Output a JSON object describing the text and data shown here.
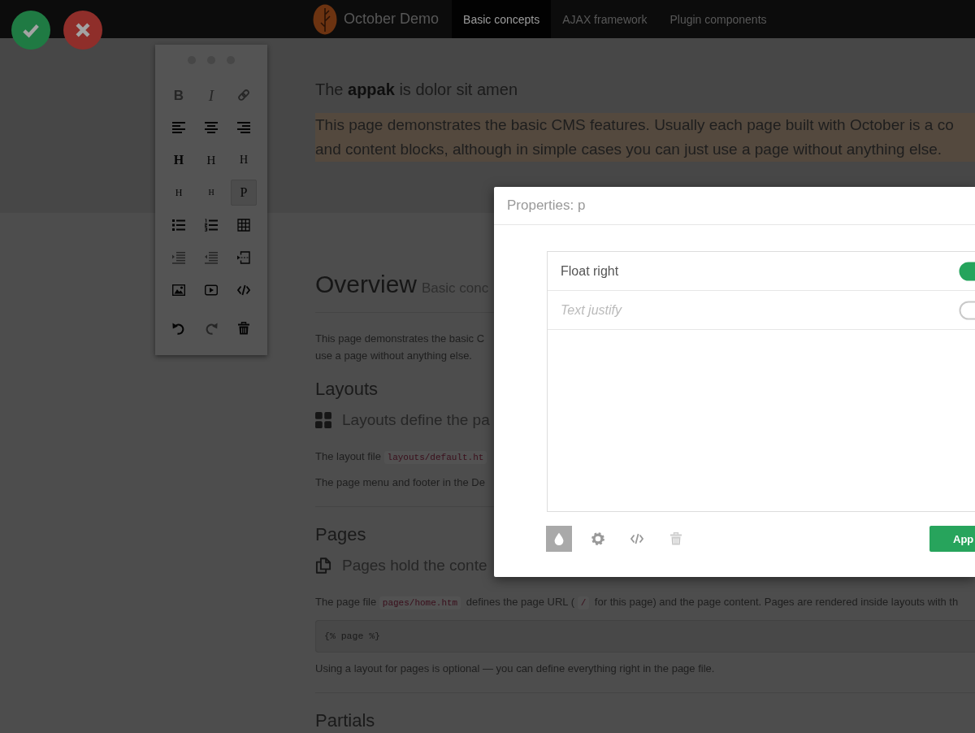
{
  "action_buttons": [
    {
      "kind": "confirm"
    },
    {
      "kind": "cancel"
    }
  ],
  "navbar": {
    "brand": "October Demo",
    "items": [
      {
        "label": "Basic concepts",
        "selected": true
      },
      {
        "label": "AJAX framework",
        "selected": false
      },
      {
        "label": "Plugin components",
        "selected": false
      }
    ]
  },
  "toolbar": {
    "format_buttons": [
      {
        "kind": "bold",
        "label": "B",
        "selected": false,
        "disabled": true
      },
      {
        "kind": "italic",
        "label": "I",
        "selected": false,
        "disabled": true
      },
      {
        "kind": "link",
        "selected": false,
        "disabled": true
      },
      {
        "kind": "align-left",
        "selected": false,
        "disabled": false
      },
      {
        "kind": "align-center",
        "selected": false,
        "disabled": false
      },
      {
        "kind": "align-right",
        "selected": false,
        "disabled": false
      },
      {
        "kind": "h1",
        "label": "H",
        "selected": false,
        "disabled": false
      },
      {
        "kind": "h2",
        "label": "H",
        "selected": false,
        "disabled": false
      },
      {
        "kind": "h3",
        "label": "H",
        "selected": false,
        "disabled": false
      },
      {
        "kind": "h4",
        "label": "H",
        "selected": false,
        "disabled": false
      },
      {
        "kind": "h5",
        "label": "H",
        "selected": false,
        "disabled": false
      },
      {
        "kind": "paragraph",
        "label": "P",
        "selected": true,
        "disabled": false
      },
      {
        "kind": "bullets",
        "selected": false,
        "disabled": false
      },
      {
        "kind": "numbers",
        "selected": false,
        "disabled": false
      },
      {
        "kind": "table",
        "selected": false,
        "disabled": false
      },
      {
        "kind": "indent",
        "selected": false,
        "disabled": true
      },
      {
        "kind": "outdent",
        "selected": false,
        "disabled": true
      },
      {
        "kind": "break",
        "selected": false,
        "disabled": false
      },
      {
        "kind": "image",
        "selected": false,
        "disabled": false
      },
      {
        "kind": "video",
        "selected": false,
        "disabled": false
      },
      {
        "kind": "code",
        "selected": false,
        "disabled": false
      }
    ],
    "history_buttons": [
      {
        "kind": "undo",
        "selected": false,
        "disabled": false
      },
      {
        "kind": "redo",
        "selected": false,
        "disabled": true
      },
      {
        "kind": "delete",
        "selected": false,
        "disabled": false
      }
    ]
  },
  "editor": {
    "heading": "The **appak** is dolor sit amen",
    "paragraph": {
      "selected": true,
      "lines": [
        "This page demonstrates the basic CMS features. Usually each page built with October is a co",
        "and content blocks, although in simple cases you can just use a page without anything else."
      ]
    }
  },
  "page_header": {
    "title": "Overview",
    "subtitle": "Basic conc"
  },
  "intro": {
    "lines": [
      "This page demonstrates the basic C",
      "use a page without anything else."
    ]
  },
  "sections": [
    {
      "heading": "Layouts",
      "separated": false,
      "lead": "Layouts define the pa",
      "body": [
        {
          "kind": "paragraph",
          "parts": [
            {
              "kind": "text",
              "text": "The layout file "
            },
            {
              "kind": "code",
              "text": "layouts/default.ht"
            }
          ]
        },
        {
          "kind": "paragraph",
          "parts": [
            {
              "kind": "text",
              "text": "The page menu and footer in the De"
            }
          ]
        }
      ]
    },
    {
      "heading": "Pages",
      "separated": true,
      "lead": "Pages hold the conte",
      "body": [
        {
          "kind": "paragraph",
          "parts": [
            {
              "kind": "text",
              "text": "The page file "
            },
            {
              "kind": "code",
              "text": "pages/home.htm"
            },
            {
              "kind": "text",
              "text": " defines the page URL ( "
            },
            {
              "kind": "code",
              "text": "/"
            },
            {
              "kind": "text",
              "text": " for this page) and the page content. Pages are rendered inside layouts with th"
            }
          ]
        },
        {
          "kind": "code_block",
          "text": "{% page %}"
        },
        {
          "kind": "paragraph",
          "parts": [
            {
              "kind": "text",
              "text": "Using a layout for pages is optional — you can define everything right in the page file."
            }
          ]
        }
      ]
    },
    {
      "heading": "Partials",
      "separated": true
    }
  ],
  "dialog": {
    "title": "Properties: p",
    "properties": [
      {
        "label": "Float right",
        "on": true,
        "disabled": false
      },
      {
        "label": "Text justify",
        "on": false,
        "disabled": true
      }
    ],
    "tools": [
      {
        "kind": "style",
        "selected": true,
        "disabled": false
      },
      {
        "kind": "settings",
        "selected": false,
        "disabled": false
      },
      {
        "kind": "code",
        "selected": false,
        "disabled": false
      },
      {
        "kind": "delete",
        "selected": false,
        "disabled": true
      }
    ],
    "apply_label": "App"
  }
}
